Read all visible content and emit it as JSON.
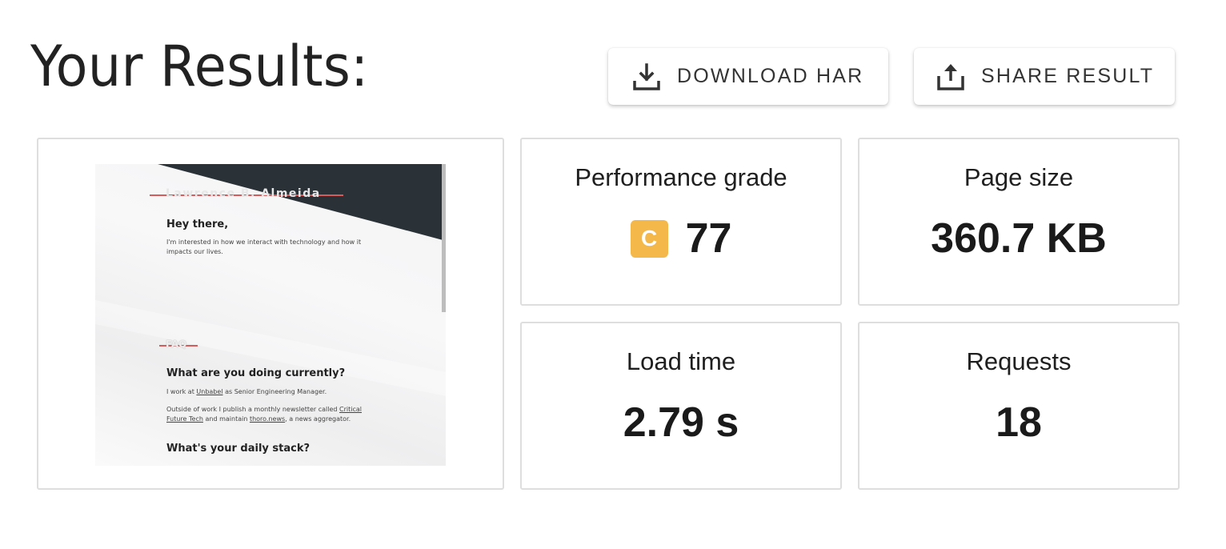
{
  "header": {
    "title": "Your Results:",
    "download_label": "DOWNLOAD HAR",
    "share_label": "SHARE RESULT"
  },
  "screenshot": {
    "site_name": "Lawrence B. Almeida",
    "greeting": "Hey there,",
    "intro": "I'm interested in how we interact with technology and how it impacts our lives.",
    "faq_heading": "FAQ",
    "q1": "What are you doing currently?",
    "a1_prefix": "I work at ",
    "a1_link": "Unbabel",
    "a1_suffix": " as Senior Engineering Manager.",
    "a2_prefix": "Outside of work I publish a monthly newsletter called ",
    "a2_link1": "Critical Future Tech",
    "a2_mid": " and maintain ",
    "a2_link2": "thoro.news",
    "a2_suffix": ", a news aggregator.",
    "q2": "What's your daily stack?"
  },
  "metrics": {
    "grade_label": "Performance grade",
    "grade_letter": "C",
    "grade_value": "77",
    "grade_color": "#f4b84a",
    "size_label": "Page size",
    "size_value": "360.7 KB",
    "load_label": "Load time",
    "load_value": "2.79 s",
    "requests_label": "Requests",
    "requests_value": "18"
  }
}
